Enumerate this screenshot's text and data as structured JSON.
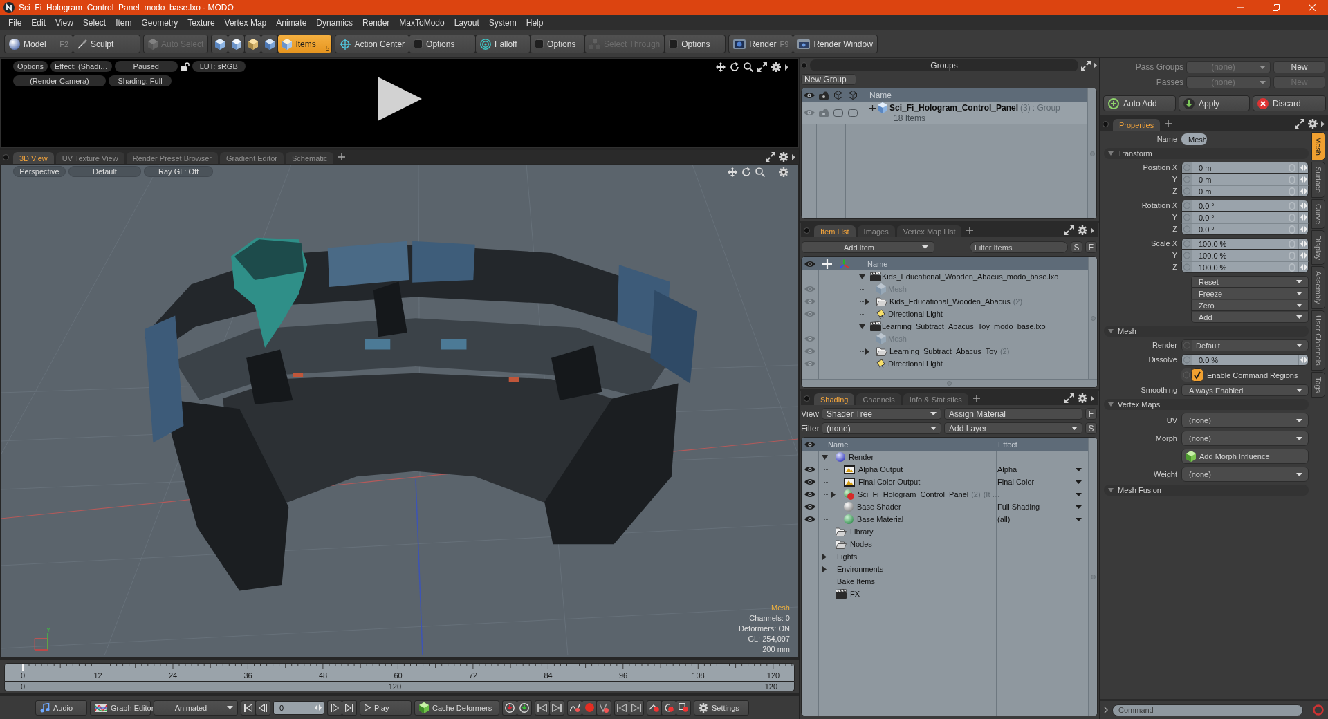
{
  "window": {
    "title": "Sci_Fi_Hologram_Control_Panel_modo_base.lxo - MODO"
  },
  "menu": [
    "File",
    "Edit",
    "View",
    "Select",
    "Item",
    "Geometry",
    "Texture",
    "Vertex Map",
    "Animate",
    "Dynamics",
    "Render",
    "MaxToModo",
    "Layout",
    "System",
    "Help"
  ],
  "toolbar": [
    {
      "items": [
        {
          "kind": "button",
          "label": "Model",
          "shortcut": "F2",
          "disabled": false
        },
        {
          "kind": "button",
          "label": "Sculpt",
          "disabled": false
        }
      ]
    },
    {
      "items": [
        {
          "kind": "button",
          "label": "Auto Select",
          "disabled": true
        }
      ]
    },
    {
      "items": [
        {
          "kind": "mode",
          "selected": false
        },
        {
          "kind": "mode",
          "selected": false
        },
        {
          "kind": "mode",
          "selected": false
        },
        {
          "kind": "mode",
          "selected": false
        },
        {
          "kind": "mode",
          "label": "Items",
          "shortcut": "5",
          "selected": true
        }
      ]
    },
    {
      "items": [
        {
          "kind": "button",
          "label": "Action Center",
          "disabled": false
        },
        {
          "kind": "toggle",
          "label": "Options",
          "on": false
        },
        {
          "kind": "button",
          "label": "Falloff",
          "disabled": false
        },
        {
          "kind": "toggle",
          "label": "Options",
          "on": false
        },
        {
          "kind": "button",
          "label": "Select Through",
          "disabled": true
        },
        {
          "kind": "toggle",
          "label": "Options",
          "on": false
        }
      ]
    },
    {
      "items": [
        {
          "kind": "button",
          "label": "Render",
          "shortcut": "F9",
          "disabled": false
        },
        {
          "kind": "button",
          "label": "Render Window",
          "disabled": false
        }
      ]
    }
  ],
  "render_preview": {
    "toolbars": [
      {
        "buttons": [
          "Options",
          "Effect: (Shadi…",
          "Paused",
          "LUT: sRGB"
        ]
      },
      {
        "buttons": [
          "(Render Camera)",
          "Shading: Full"
        ]
      }
    ]
  },
  "viewport_tabs": [
    {
      "label": "3D View",
      "selected": true
    },
    {
      "label": "UV Texture View",
      "selected": false
    },
    {
      "label": "Render Preset Browser",
      "selected": false
    },
    {
      "label": "Gradient Editor",
      "selected": false
    },
    {
      "label": "Schematic",
      "selected": false
    }
  ],
  "viewport": {
    "buttons": [
      "Perspective",
      "Default",
      "Ray GL: Off"
    ],
    "selection": "Mesh",
    "stats": [
      "Channels: 0",
      "Deformers: ON",
      "GL: 254,097",
      "200 mm"
    ],
    "axis_label": "Y"
  },
  "timeline": {
    "ticks": [
      "0",
      "12",
      "24",
      "36",
      "48",
      "60",
      "72",
      "84",
      "96",
      "108",
      "120"
    ],
    "range": [
      "0",
      "120",
      "120"
    ]
  },
  "transport": {
    "audio": "Audio",
    "graph_editor": "Graph Editor",
    "mode": "Animated",
    "frame": "0",
    "play": "Play",
    "cache": "Cache Deformers",
    "settings": "Settings"
  },
  "groups": {
    "title": "Groups",
    "new_button": "New Group",
    "column": "Name",
    "rows": [
      {
        "name": "Sci_Fi_Hologram_Control_Panel",
        "count": "(3)",
        "type": ": Group",
        "detail": "18 Items",
        "visible": true
      }
    ]
  },
  "item_list": {
    "tabs": [
      {
        "label": "Item List",
        "selected": true
      },
      {
        "label": "Images",
        "selected": false
      },
      {
        "label": "Vertex Map List",
        "selected": false
      }
    ],
    "add_item": "Add Item",
    "filter": {
      "placeholder": "Filter Items"
    },
    "buttons": [
      "S",
      "F"
    ],
    "column": "Name",
    "items": [
      {
        "kind": "scene",
        "name": "Kids_Educational_Wooden_Abacus_modo_base.lxo",
        "expanded": true,
        "children": [
          {
            "kind": "mesh",
            "name": "Mesh",
            "visible": true,
            "disabled": true
          },
          {
            "kind": "group",
            "name": "Kids_Educational_Wooden_Abacus",
            "count": "(2)",
            "expanded": false,
            "visible": true,
            "disabled": false
          },
          {
            "kind": "light",
            "name": "Directional Light",
            "visible": true,
            "disabled": false
          }
        ]
      },
      {
        "kind": "scene",
        "name": "Learning_Subtract_Abacus_Toy_modo_base.lxo",
        "expanded": true,
        "children": [
          {
            "kind": "mesh",
            "name": "Mesh",
            "visible": true,
            "disabled": true
          },
          {
            "kind": "group",
            "name": "Learning_Subtract_Abacus_Toy",
            "count": "(2)",
            "expanded": false,
            "visible": true,
            "disabled": false
          },
          {
            "kind": "light",
            "name": "Directional Light",
            "visible": true,
            "disabled": false
          }
        ]
      }
    ]
  },
  "shading": {
    "tabs": [
      {
        "label": "Shading",
        "selected": true
      },
      {
        "label": "Channels",
        "selected": false
      },
      {
        "label": "Info & Statistics",
        "selected": false
      }
    ],
    "view_label": "View",
    "view": "Shader Tree",
    "assign": "Assign Material",
    "view_button": "F",
    "filter_label": "Filter",
    "filter": "(none)",
    "add_layer": "Add Layer",
    "filter_button": "S",
    "columns": [
      "Name",
      "Effect"
    ],
    "tree": [
      {
        "kind": "render",
        "name": "Render",
        "expanded": true,
        "children": [
          {
            "kind": "output",
            "name": "Alpha Output",
            "effect": "Alpha",
            "visible": true
          },
          {
            "kind": "output",
            "name": "Final Color Output",
            "effect": "Final Color",
            "visible": true
          },
          {
            "kind": "material",
            "name": "Sci_Fi_Hologram_Control_Panel",
            "count": "(2)",
            "note": "(It …",
            "expanded": false,
            "visible": true
          },
          {
            "kind": "shader",
            "name": "Base Shader",
            "effect": "Full Shading",
            "visible": true
          },
          {
            "kind": "base-material",
            "name": "Base Material",
            "effect": "(all)",
            "visible": true
          }
        ]
      },
      {
        "kind": "folder",
        "name": "Library"
      },
      {
        "kind": "folder",
        "name": "Nodes"
      },
      {
        "kind": "category",
        "name": "Lights",
        "expanded": false
      },
      {
        "kind": "category",
        "name": "Environments",
        "expanded": false
      },
      {
        "kind": "category",
        "name": "Bake Items"
      },
      {
        "kind": "fx",
        "name": "FX"
      }
    ]
  },
  "passes": {
    "rows": [
      {
        "label": "Pass Groups",
        "value": "(none)",
        "button": "New",
        "disabled": false
      },
      {
        "label": "Passes",
        "value": "(none)",
        "button": "New",
        "disabled": true
      }
    ],
    "actions": [
      "Auto Add",
      "Apply",
      "Discard"
    ]
  },
  "properties": {
    "tabs": [
      {
        "label": "Properties",
        "selected": true
      }
    ],
    "name_label": "Name",
    "name": "Mesh",
    "side_tabs": [
      {
        "label": "Mesh",
        "selected": true
      },
      {
        "label": "Surface",
        "selected": false
      },
      {
        "label": "Curve",
        "selected": false
      },
      {
        "label": "Display",
        "selected": false
      },
      {
        "label": "Assembly",
        "selected": false
      },
      {
        "label": "User Channels",
        "selected": false
      },
      {
        "label": "Tags",
        "selected": false
      }
    ],
    "sections": [
      {
        "title": "Transform",
        "expanded": true,
        "rows": [
          {
            "kind": "vector",
            "fields": [
              {
                "label": "Position X",
                "value": "0 m"
              },
              {
                "label": "Y",
                "value": "0 m"
              },
              {
                "label": "Z",
                "value": "0 m"
              }
            ]
          },
          {
            "kind": "vector",
            "fields": [
              {
                "label": "Rotation X",
                "value": "0.0 °"
              },
              {
                "label": "Y",
                "value": "0.0 °"
              },
              {
                "label": "Z",
                "value": "0.0 °"
              }
            ]
          },
          {
            "kind": "vector",
            "fields": [
              {
                "label": "Scale X",
                "value": "100.0 %"
              },
              {
                "label": "Y",
                "value": "100.0 %"
              },
              {
                "label": "Z",
                "value": "100.0 %"
              }
            ]
          },
          {
            "kind": "menu",
            "options": [
              "Reset",
              "Freeze",
              "Zero",
              "Add"
            ]
          }
        ]
      },
      {
        "title": "Mesh",
        "expanded": true,
        "rows": [
          {
            "kind": "channel-dropdown",
            "label": "Render",
            "value": "Default"
          },
          {
            "kind": "number",
            "label": "Dissolve",
            "value": "0.0 %"
          },
          {
            "kind": "checkbox",
            "label": "Enable Command Regions",
            "checked": true
          },
          {
            "kind": "dropdown",
            "label": "Smoothing",
            "value": "Always Enabled"
          }
        ]
      },
      {
        "title": "Vertex Maps",
        "expanded": true,
        "rows": [
          {
            "kind": "map-dropdown",
            "label": "UV",
            "value": "(none)"
          },
          {
            "kind": "map-dropdown",
            "label": "Morph",
            "value": "(none)"
          },
          {
            "kind": "button",
            "label": "Add Morph Influence"
          },
          {
            "kind": "map-dropdown",
            "label": "Weight",
            "value": "(none)"
          }
        ]
      },
      {
        "title": "Mesh Fusion",
        "expanded": true
      }
    ]
  },
  "command": {
    "placeholder": "Command"
  }
}
